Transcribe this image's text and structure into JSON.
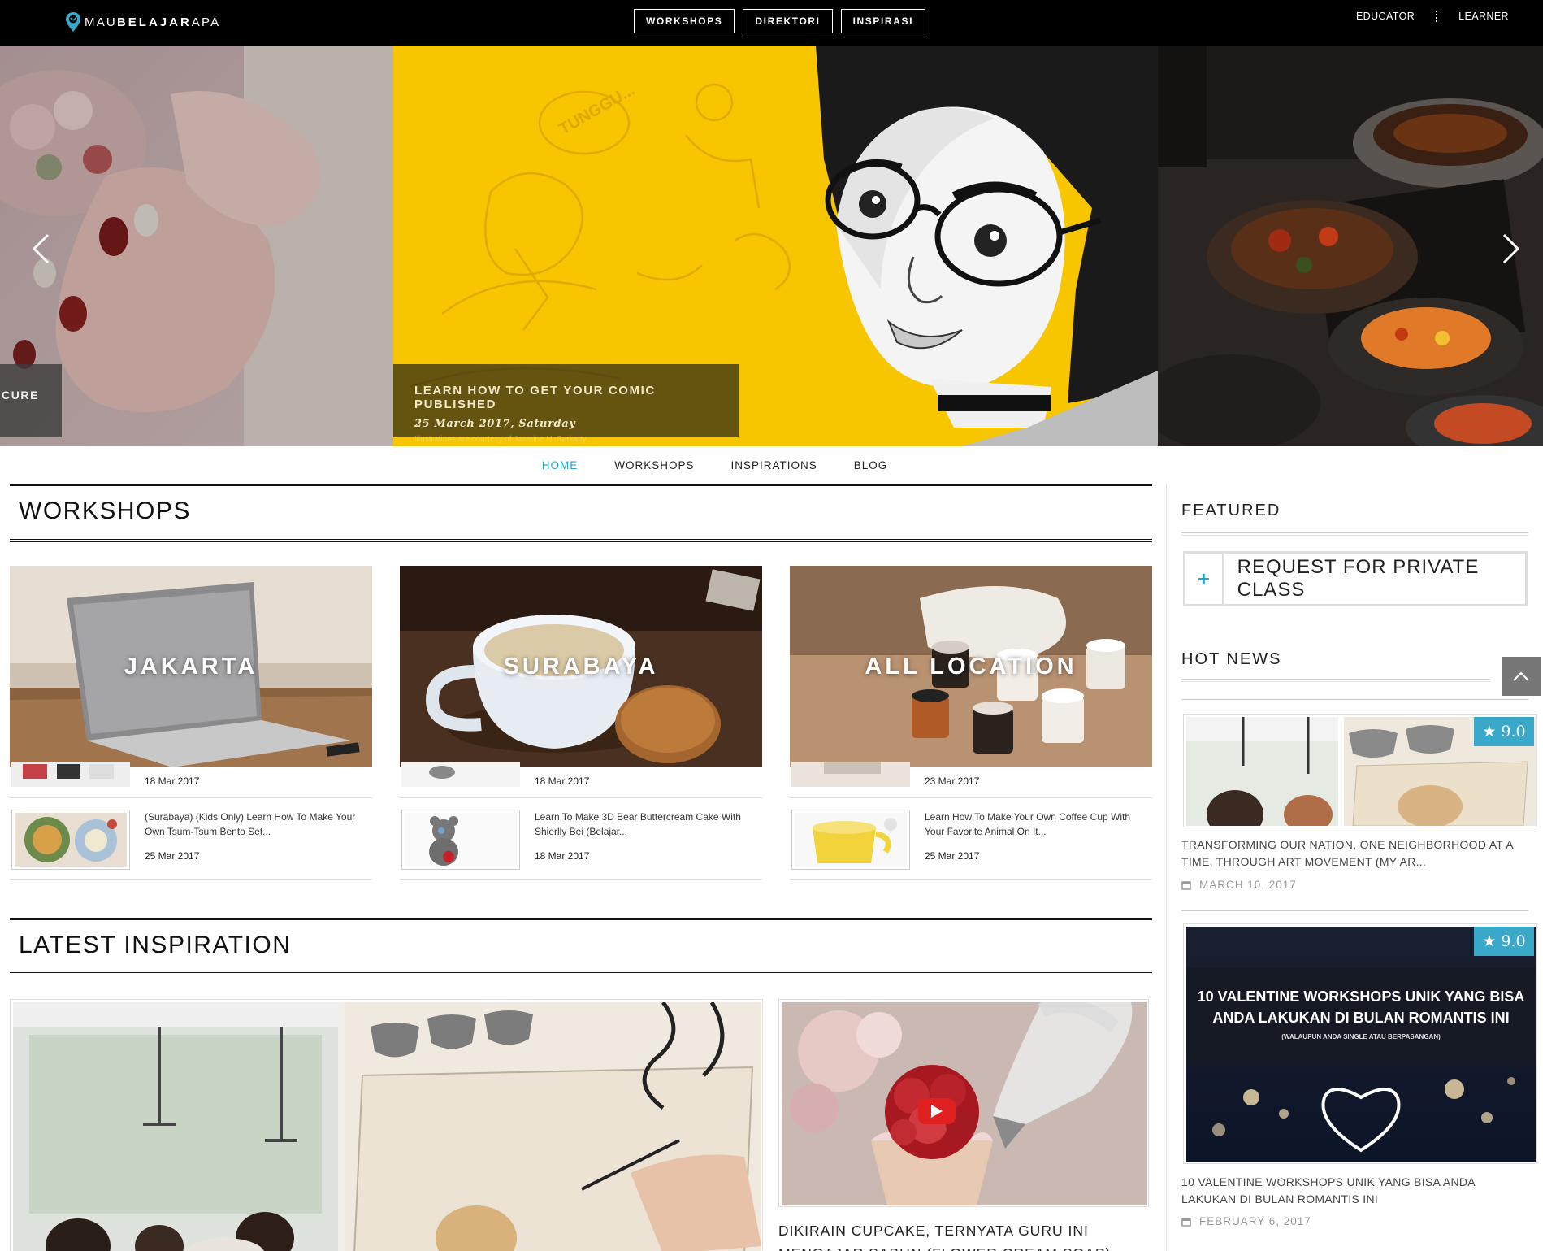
{
  "brand": {
    "prefix": "MAU",
    "bold": "BELAJAR",
    "suffix": "APA"
  },
  "topnav": [
    "WORKSHOPS",
    "DIREKTORI",
    "INSPIRASI"
  ],
  "usernav": {
    "educator": "EDUCATOR",
    "learner": "LEARNER"
  },
  "hero": {
    "left_caption": "CURE",
    "main_caption_title": "LEARN HOW TO GET YOUR COMIC PUBLISHED",
    "main_caption_date": "25 March 2017, Saturday",
    "main_caption_credit": "Illustrations are courtesy of Jasmine H. Surkatty",
    "bubble_text": "TUNGGU...",
    "prev_icon": "chevron-left-icon",
    "next_icon": "chevron-right-icon"
  },
  "subnav": [
    {
      "label": "HOME",
      "active": true
    },
    {
      "label": "WORKSHOPS",
      "active": false
    },
    {
      "label": "INSPIRATIONS",
      "active": false
    },
    {
      "label": "BLOG",
      "active": false
    }
  ],
  "workshops": {
    "heading": "WORKSHOPS",
    "columns": [
      {
        "city": "JAKARTA",
        "first_date": "18 Mar 2017",
        "item": {
          "title": "(Surabaya) (Kids Only) Learn How To Make Your Own Tsum-Tsum Bento Set...",
          "date": "25 Mar 2017"
        }
      },
      {
        "city": "SURABAYA",
        "first_date": "18 Mar 2017",
        "item": {
          "title": "Learn To Make 3D Bear Buttercream Cake With Shierlly Bei (Belajar...",
          "date": "18 Mar 2017"
        }
      },
      {
        "city": "ALL LOCATION",
        "first_date": "23 Mar 2017",
        "item": {
          "title": "Learn How To Make Your Own Coffee Cup With Your Favorite Animal On It...",
          "date": "25 Mar 2017"
        }
      }
    ]
  },
  "inspiration": {
    "heading": "LATEST INSPIRATION",
    "video_title": "DIKIRAIN CUPCAKE, TERNYATA GURU INI MENGAJAR SABUN (FLOWER CREAM SOAP)"
  },
  "sidebar": {
    "featured_heading": "FEATURED",
    "request_plus": "+",
    "request_label": "REQUEST FOR PRIVATE CLASS",
    "hot_news_heading": "HOT NEWS",
    "news": [
      {
        "rating": "9.0",
        "title": "TRANSFORMING OUR NATION, ONE NEIGHBORHOOD AT A TIME, THROUGH ART MOVEMENT (MY AR...",
        "date": "MARCH 10, 2017"
      },
      {
        "rating": "9.0",
        "title": "10 VALENTINE WORKSHOPS UNIK YANG BISA ANDA LAKUKAN DI BULAN ROMANTIS INI",
        "date": "FEBRUARY 6, 2017",
        "banner_line1": "10 VALENTINE WORKSHOPS UNIK YANG BISA",
        "banner_line2": "ANDA LAKUKAN DI BULAN ROMANTIS INI",
        "banner_small": "(WALAUPUN ANDA SINGLE ATAU BERPASANGAN)"
      }
    ]
  },
  "colors": {
    "accent": "#29a3c2",
    "rating_bg": "#3aa9c9",
    "topbar": "#000000",
    "hero_yellow": "#f7c600"
  }
}
